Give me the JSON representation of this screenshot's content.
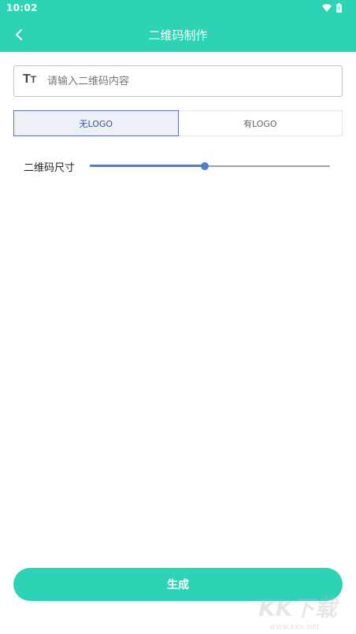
{
  "status_bar": {
    "time": "10:02"
  },
  "app_bar": {
    "title": "二维码制作"
  },
  "content_input": {
    "placeholder": "请输入二维码内容",
    "value": ""
  },
  "logo_toggle": {
    "options": [
      "无LOGO",
      "有LOGO"
    ],
    "selected": "无LOGO"
  },
  "size": {
    "label": "二维码尺寸",
    "value_fraction": 0.48
  },
  "generate_button": {
    "label": "生成"
  },
  "watermark": {
    "brand": "KK下载",
    "url": "www.kkx.net"
  },
  "colors": {
    "accent": "#2dd3b5",
    "selected_border": "#5b6fb8",
    "slider": "#4a7fd8"
  }
}
